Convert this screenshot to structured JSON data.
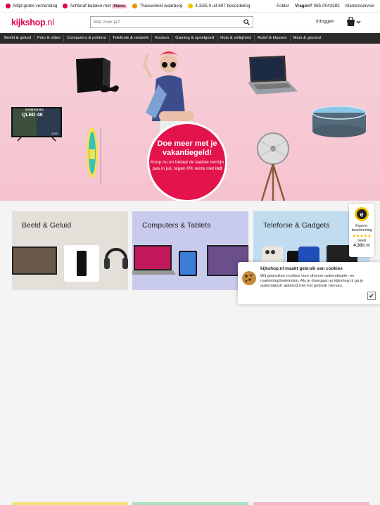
{
  "usp_bar": {
    "items": [
      "Altijd gratis verzending",
      "Achteraf betalen met",
      "Thuiswinkel waarborg",
      "4.33/5.0 uit 607 beoordeling"
    ],
    "klarna": "Klarna.",
    "folder": "Folder",
    "questions_label": "Vragen?",
    "phone": "085-0043383",
    "service": "Klantenservice"
  },
  "header": {
    "logo_main": "kijkshop",
    "logo_tld": ".nl",
    "search_placeholder": "Wat zoek je?",
    "login": "Inloggen"
  },
  "nav": {
    "items": [
      "Beeld & geluid",
      "Foto & video",
      "Computers & printers",
      "Telefonie & netwerk",
      "Keuken",
      "Gaming & speelgoed",
      "Huis & veiligheid",
      "Actief & klussen",
      "Mooi & gezond"
    ]
  },
  "hero": {
    "title": "Doe meer met je vakantiegeld!",
    "body": "Koop nu en betaal de laatste termijn pas in juli, tegen 0% rente met",
    "tv_brand": "SAMSUNG",
    "tv_model": "QLED 4K",
    "tv_year": "2020"
  },
  "categories": [
    {
      "label": "Beeld & Geluid",
      "bg": "#e3e0da"
    },
    {
      "label": "Computers & Tablets",
      "bg": "#c9cbec"
    },
    {
      "label": "Telefonie & Gadgets",
      "bg": "#c2dcef"
    }
  ],
  "trust_badge": {
    "label": "Kopers-bescherming",
    "rating_word": "Goed",
    "score": "4.33",
    "scale": "/5.00"
  },
  "cookie": {
    "title": "kijkshop.nl maakt gebruik van cookies",
    "body": "Wij gebruiken cookies voor diverse optimalisatie- en marketingdoeleinden. Als je doorgaat op kijkshop.nl ga je automatisch akkoord met het gebruik hiervan."
  },
  "colors": {
    "brand": "#e0004d",
    "nav_bg": "#2a2a2a",
    "hero_bg": "#f6c9d3",
    "badge": "#e3134b"
  }
}
